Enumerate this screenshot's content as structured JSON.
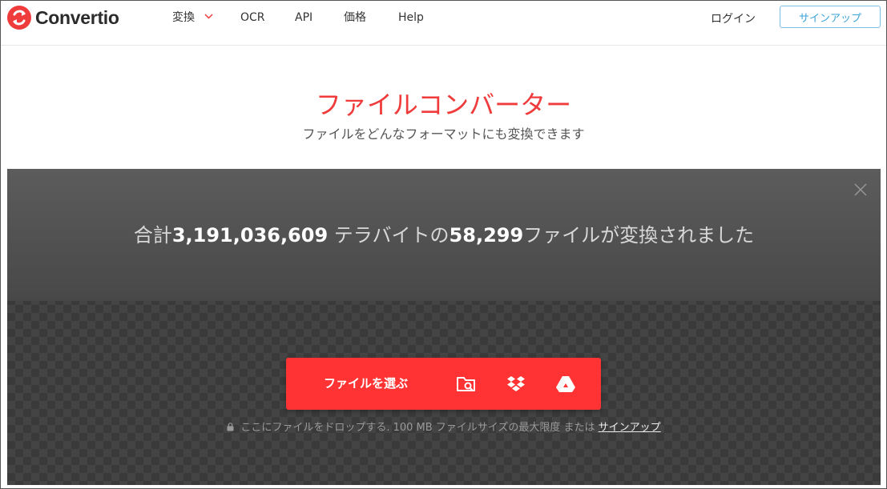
{
  "brand": {
    "name": "Convertio",
    "accent": "#ef3b3b"
  },
  "nav": {
    "items": [
      {
        "label": "変換",
        "has_dropdown": true
      },
      {
        "label": "OCR"
      },
      {
        "label": "API"
      },
      {
        "label": "価格"
      },
      {
        "label": "Help"
      }
    ],
    "login": "ログイン",
    "signup": "サインアップ"
  },
  "hero": {
    "title": "ファイルコンバーター",
    "subtitle": "ファイルをどんなフォーマットにも変換できます"
  },
  "stats": {
    "prefix": "合計",
    "terabytes": "3,191,036,609",
    "middle": " テラバイトの",
    "files": "58,299",
    "suffix": "ファイルが変換されました"
  },
  "uploader": {
    "choose_label": "ファイルを選ぶ",
    "icons": [
      "folder-search-icon",
      "dropbox-icon",
      "google-drive-icon"
    ],
    "note_text": "ここにファイルをドロップする. 100 MB ファイルサイズの最大限度 または ",
    "note_link": "サインアップ"
  }
}
